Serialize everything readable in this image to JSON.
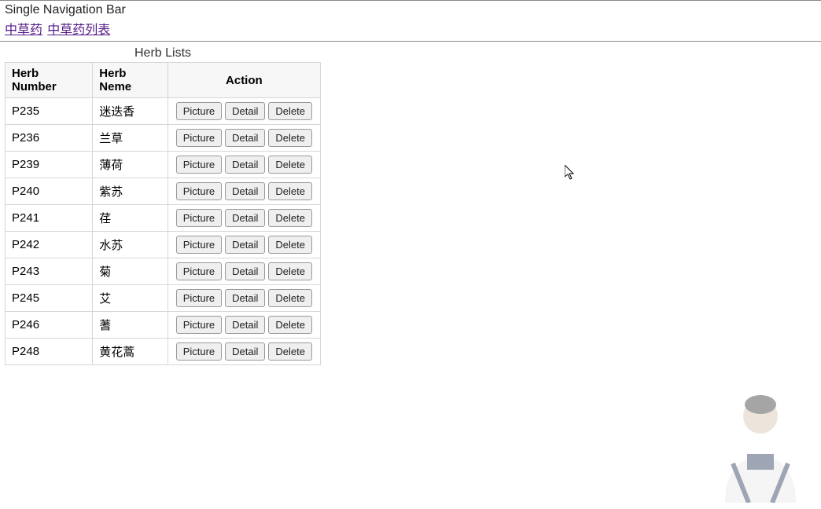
{
  "nav": {
    "title": "Single Navigation Bar",
    "link1": "中草药",
    "link2": "中草药列表"
  },
  "table": {
    "caption": "Herb Lists",
    "headers": {
      "number": "Herb Number",
      "name": "Herb Neme",
      "action": "Action"
    },
    "action_labels": {
      "picture": "Picture",
      "detail": "Detail",
      "delete": "Delete"
    },
    "rows": [
      {
        "number": "P235",
        "name": "迷迭香"
      },
      {
        "number": "P236",
        "name": "兰草"
      },
      {
        "number": "P239",
        "name": "薄荷"
      },
      {
        "number": "P240",
        "name": "紫苏"
      },
      {
        "number": "P241",
        "name": "荏"
      },
      {
        "number": "P242",
        "name": "水苏"
      },
      {
        "number": "P243",
        "name": "菊"
      },
      {
        "number": "P245",
        "name": "艾"
      },
      {
        "number": "P246",
        "name": "蓍"
      },
      {
        "number": "P248",
        "name": "黄花蒿"
      }
    ]
  }
}
